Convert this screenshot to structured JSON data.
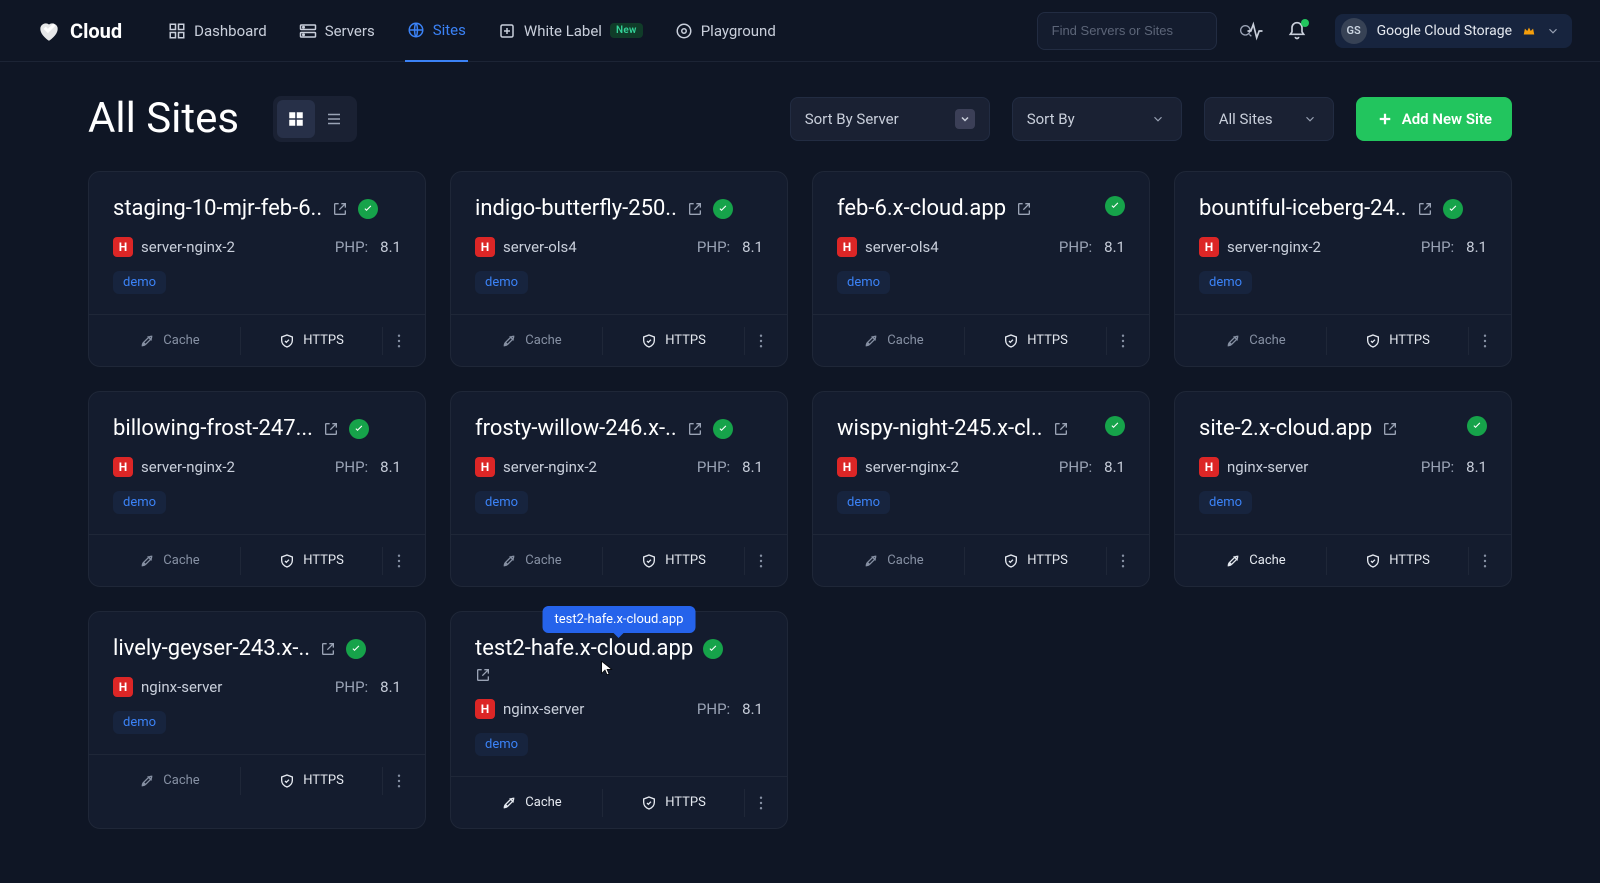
{
  "brand": "Cloud",
  "nav": {
    "dashboard": "Dashboard",
    "servers": "Servers",
    "sites": "Sites",
    "white_label": "White Label",
    "new_badge": "New",
    "playground": "Playground"
  },
  "search": {
    "placeholder": "Find Servers or Sites"
  },
  "account": {
    "initials": "GS",
    "name": "Google Cloud Storage"
  },
  "page_title": "All Sites",
  "controls": {
    "sort_by_server": "Sort By Server",
    "sort_by": "Sort By",
    "filter": "All Sites",
    "add_new": "Add New Site"
  },
  "labels": {
    "php": "PHP:",
    "cache": "Cache",
    "https": "HTTPS",
    "demo": "demo"
  },
  "tooltip": "test2-hafe.x-cloud.app",
  "sites": [
    {
      "name": "staging-10-mjr-feb-6..",
      "server": "server-nginx-2",
      "php": "8.1",
      "cache_on": false
    },
    {
      "name": "indigo-butterfly-250..",
      "server": "server-ols4",
      "php": "8.1",
      "cache_on": false
    },
    {
      "name": "feb-6.x-cloud.app",
      "server": "server-ols4",
      "php": "8.1",
      "cache_on": false,
      "status_abs": true
    },
    {
      "name": "bountiful-iceberg-24..",
      "server": "server-nginx-2",
      "php": "8.1",
      "cache_on": false
    },
    {
      "name": "billowing-frost-247...",
      "server": "server-nginx-2",
      "php": "8.1",
      "cache_on": false
    },
    {
      "name": "frosty-willow-246.x-..",
      "server": "server-nginx-2",
      "php": "8.1",
      "cache_on": false
    },
    {
      "name": "wispy-night-245.x-cl..",
      "server": "server-nginx-2",
      "php": "8.1",
      "cache_on": false,
      "status_abs": true
    },
    {
      "name": "site-2.x-cloud.app",
      "server": "nginx-server",
      "php": "8.1",
      "cache_on": true,
      "status_abs": true
    },
    {
      "name": "lively-geyser-243.x-..",
      "server": "nginx-server",
      "php": "8.1",
      "cache_on": false
    },
    {
      "name": "test2-hafe.x-cloud.app",
      "server": "nginx-server",
      "php": "8.1",
      "cache_on": true,
      "tooltip": true,
      "ext_below": true
    }
  ]
}
